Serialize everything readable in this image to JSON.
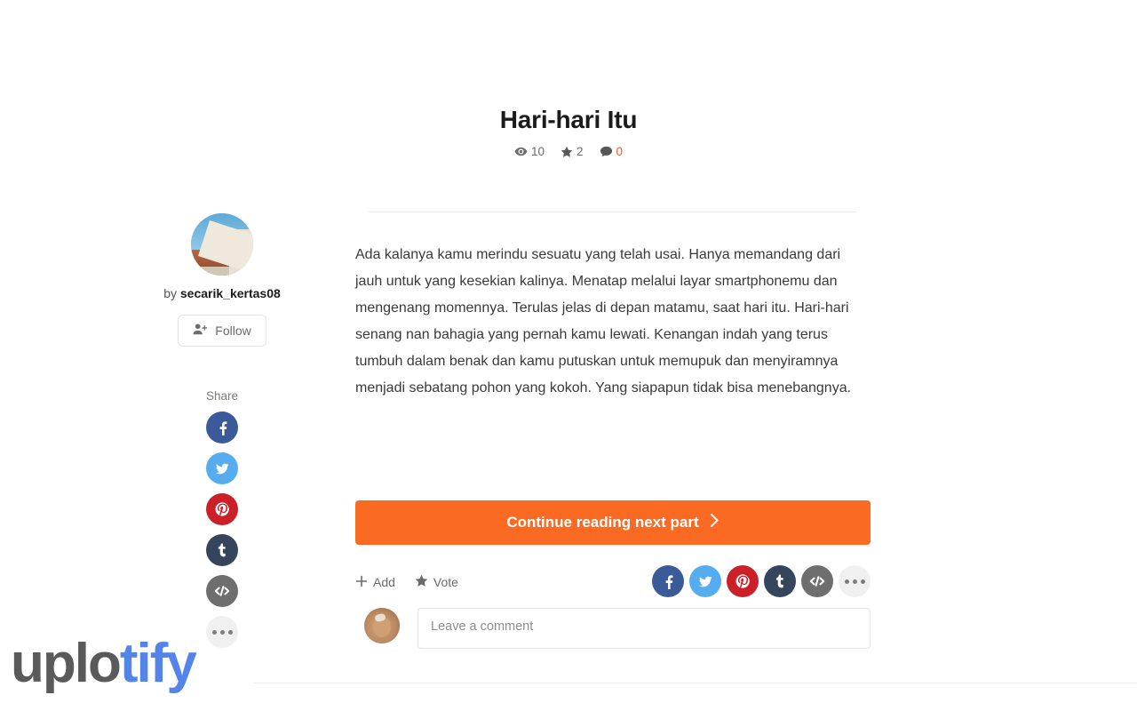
{
  "article": {
    "title": "Hari-hari Itu",
    "stats": [
      {
        "icon": "eye-icon",
        "name": "views",
        "value": "10",
        "accent": false
      },
      {
        "icon": "star-icon",
        "name": "votes",
        "value": "2",
        "accent": false
      },
      {
        "icon": "comment-icon",
        "name": "comments",
        "value": "0",
        "accent": true
      }
    ],
    "body": "Ada kalanya kamu merindu sesuatu yang telah usai. Hanya memandang dari jauh untuk yang kesekian kalinya. Menatap melalui layar smartphonemu dan mengenang momennya. Terulas jelas di depan matamu, saat hari itu. Hari-hari senang nan bahagia yang pernah kamu lewati. Kenangan indah yang terus tumbuh dalam benak dan kamu putuskan untuk memupuk dan menyiramnya menjadi sebatang pohon yang kokoh. Yang siapapun tidak bisa menebangnya."
  },
  "author": {
    "by_label": "by",
    "username": "secarik_kertas08",
    "follow_label": "Follow",
    "avatar_alt": "author-photo"
  },
  "share": {
    "label": "Share",
    "items": [
      {
        "name": "facebook",
        "icon": "facebook-icon",
        "color": "#3b5a9a"
      },
      {
        "name": "twitter",
        "icon": "twitter-icon",
        "color": "#55acee"
      },
      {
        "name": "pinterest",
        "icon": "pinterest-icon",
        "color": "#cb2027"
      },
      {
        "name": "tumblr",
        "icon": "tumblr-icon",
        "color": "#35465c"
      },
      {
        "name": "embed",
        "icon": "code-icon",
        "color": "#6e6e6e"
      },
      {
        "name": "more",
        "icon": "ellipsis-icon",
        "color": "#f0f0f0"
      }
    ]
  },
  "cta": {
    "label": "Continue reading next part",
    "chevron": "chevron-right-icon",
    "color": "#fb6a22"
  },
  "actions": [
    {
      "name": "add",
      "icon": "plus-icon",
      "label": "Add"
    },
    {
      "name": "vote",
      "icon": "star-icon",
      "label": "Vote"
    }
  ],
  "comment": {
    "placeholder": "Leave a comment",
    "value": "",
    "avatar_alt": "current-user-photo"
  },
  "watermark": {
    "part1": "uplo",
    "part2": "tify",
    "color1": "#5a5a5a",
    "color2": "#5584e8"
  }
}
